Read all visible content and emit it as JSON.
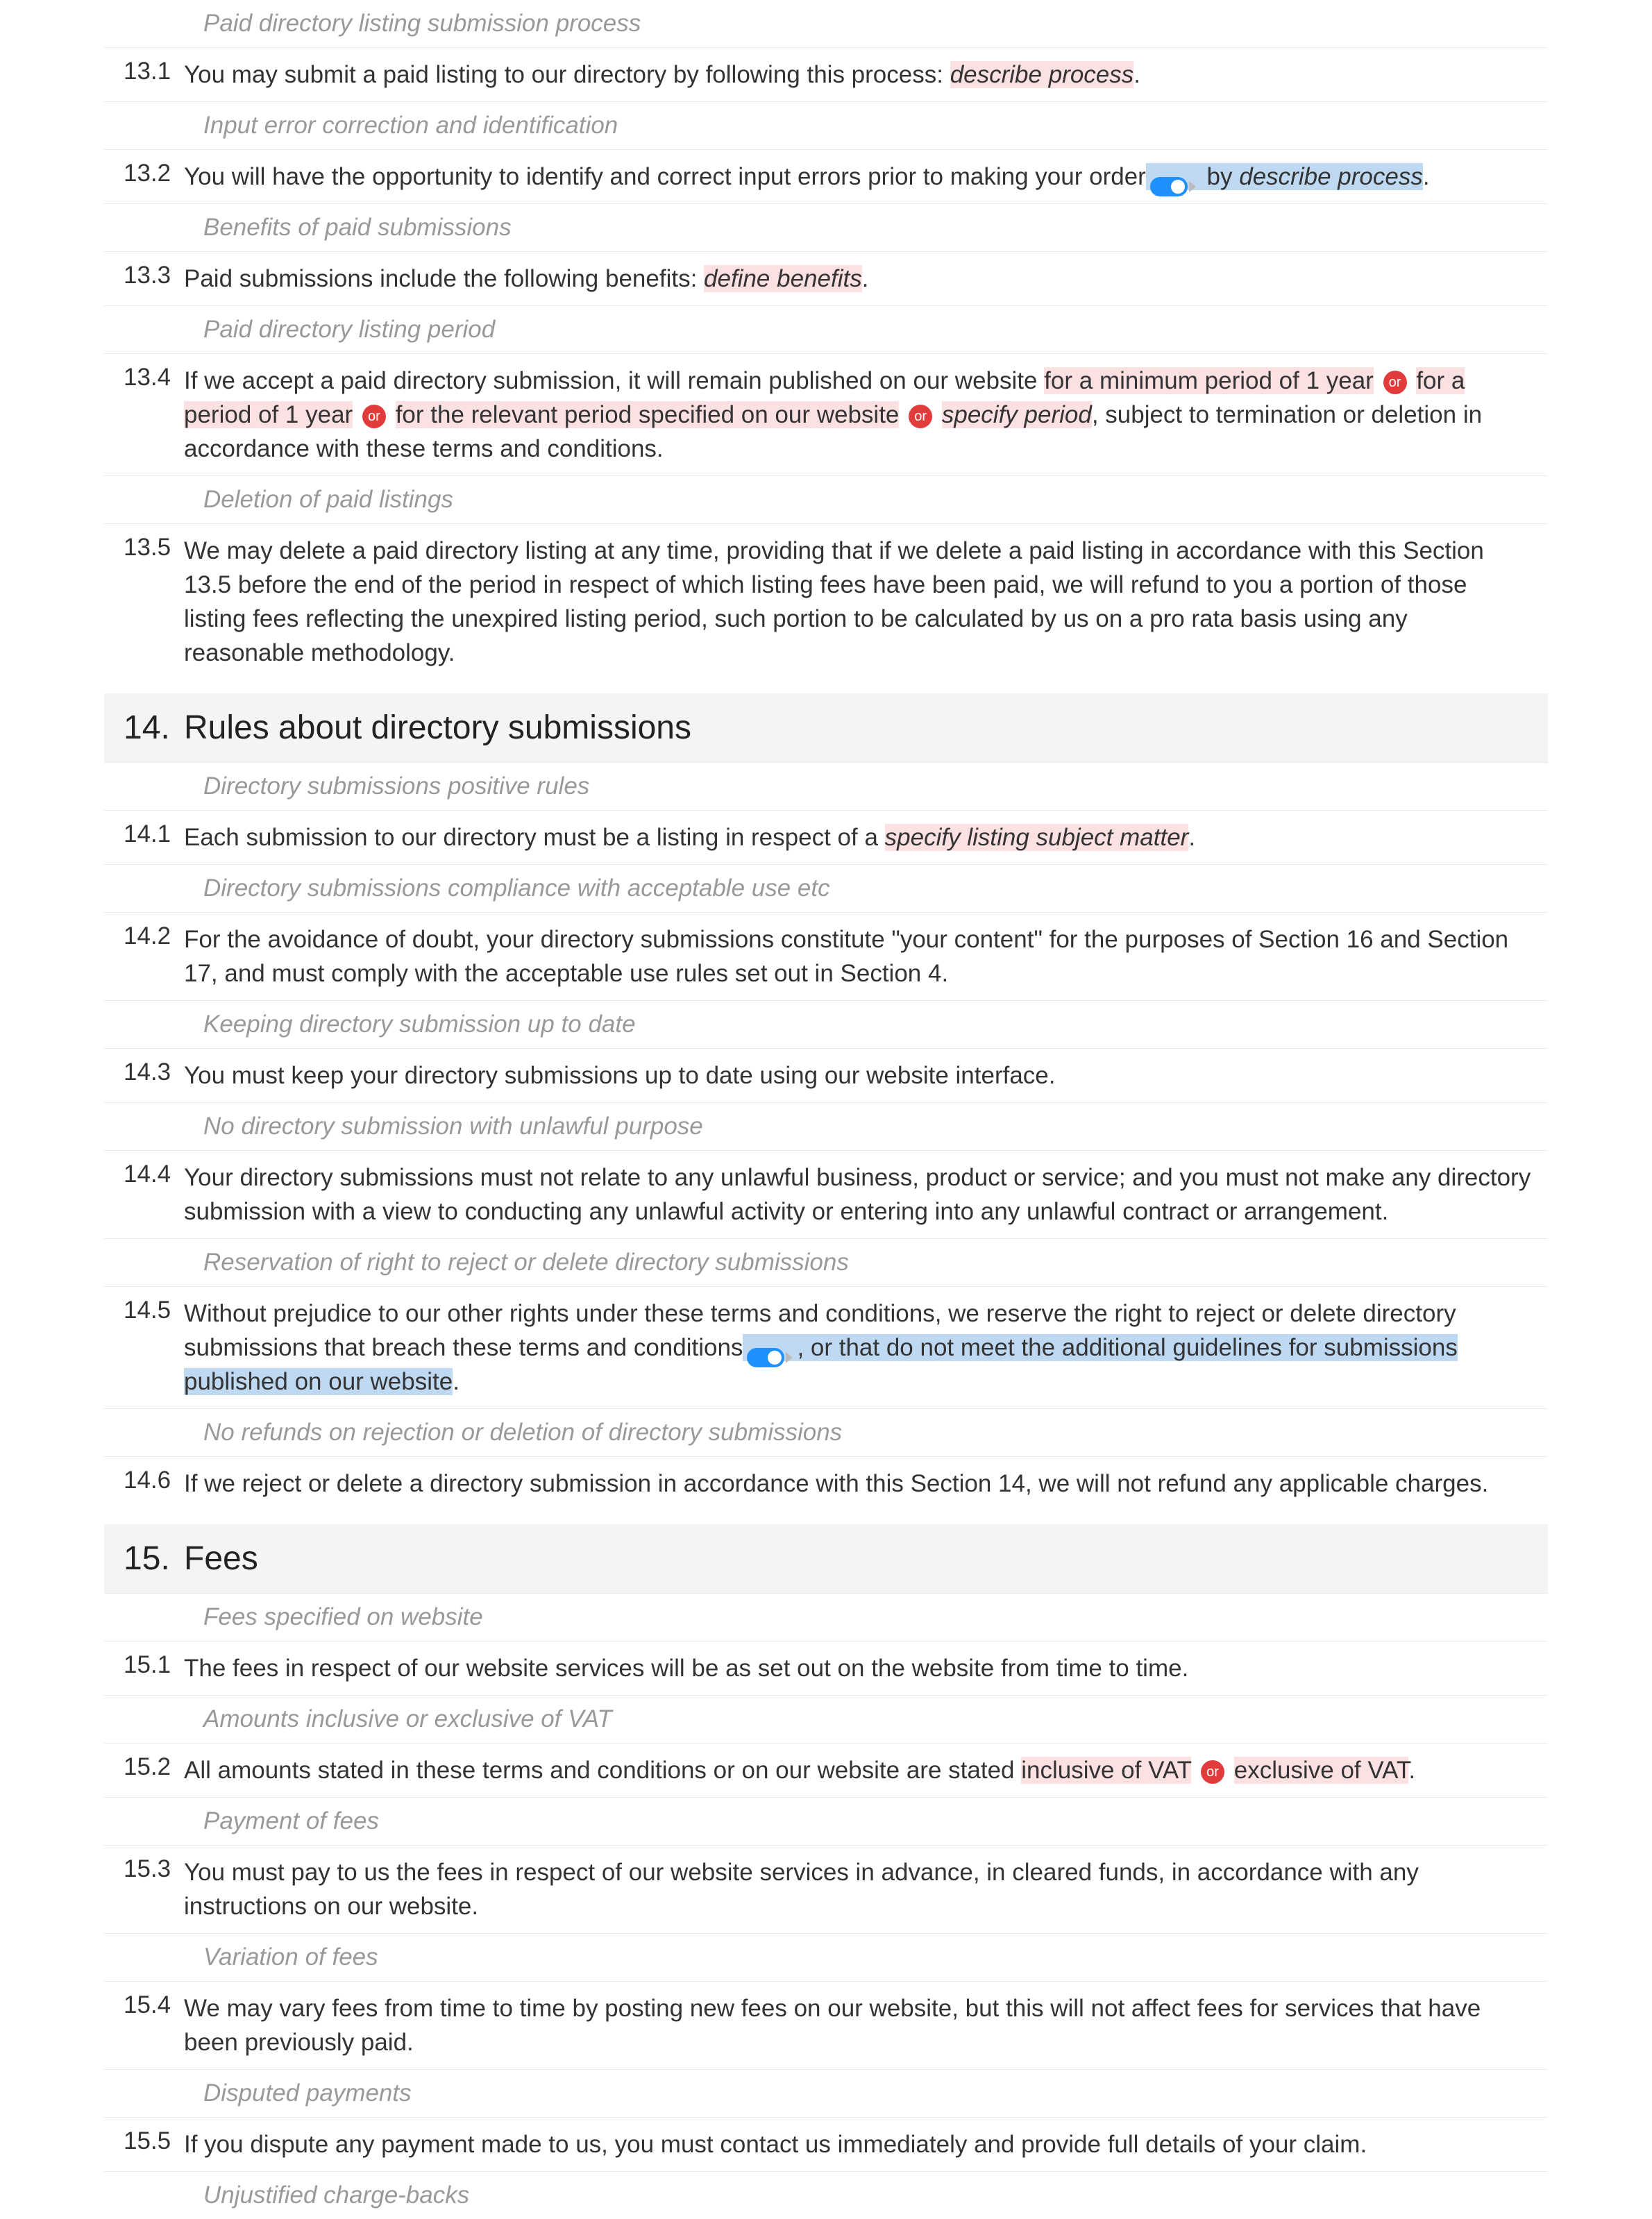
{
  "blocks": [
    {
      "type": "subheading",
      "text": "Paid directory listing submission process",
      "first": true
    },
    {
      "type": "clause",
      "num": "13.1",
      "segments": [
        {
          "text": "You may submit a paid listing to our directory by following this process: "
        },
        {
          "text": "describe process",
          "hl": "pink",
          "italic": true
        },
        {
          "text": "."
        }
      ]
    },
    {
      "type": "subheading",
      "text": "Input error correction and identification"
    },
    {
      "type": "clause",
      "num": "13.2",
      "segments": [
        {
          "text": "You will have the opportunity to identify and correct input errors prior to making your order"
        },
        {
          "toggle": true,
          "hl": "blue"
        },
        {
          "text": " by ",
          "hl": "blue"
        },
        {
          "text": "describe process",
          "hl": "blue",
          "italic": true
        },
        {
          "text": "."
        }
      ]
    },
    {
      "type": "subheading",
      "text": "Benefits of paid submissions"
    },
    {
      "type": "clause",
      "num": "13.3",
      "segments": [
        {
          "text": "Paid submissions include the following benefits: "
        },
        {
          "text": "define benefits",
          "hl": "pink",
          "italic": true
        },
        {
          "text": "."
        }
      ]
    },
    {
      "type": "subheading",
      "text": "Paid directory listing period"
    },
    {
      "type": "clause",
      "num": "13.4",
      "segments": [
        {
          "text": "If we accept a paid directory submission, it will remain published on our website "
        },
        {
          "text": "for a minimum period of 1 year",
          "hl": "pink"
        },
        {
          "or": true
        },
        {
          "text": "for a period of 1 year",
          "hl": "pink"
        },
        {
          "or": true
        },
        {
          "text": "for the relevant period specified on our website",
          "hl": "pink"
        },
        {
          "or": true
        },
        {
          "text": "specify period",
          "hl": "pink",
          "italic": true
        },
        {
          "text": ", subject to termination or deletion in accordance with these terms and conditions."
        }
      ]
    },
    {
      "type": "subheading",
      "text": "Deletion of paid listings"
    },
    {
      "type": "clause",
      "num": "13.5",
      "segments": [
        {
          "text": "We may delete a paid directory listing at any time, providing that if we delete a paid listing in accordance with this Section 13.5 before the end of the period in respect of which listing fees have been paid, we will refund to you a portion of those listing fees reflecting the unexpired listing period, such portion to be calculated by us on a pro rata basis using any reasonable methodology."
        }
      ]
    },
    {
      "type": "section",
      "num": "14.",
      "title": "Rules about directory submissions"
    },
    {
      "type": "subheading",
      "text": "Directory submissions positive rules"
    },
    {
      "type": "clause",
      "num": "14.1",
      "segments": [
        {
          "text": "Each submission to our directory must be a listing in respect of a "
        },
        {
          "text": "specify listing subject matter",
          "hl": "pink",
          "italic": true
        },
        {
          "text": "."
        }
      ]
    },
    {
      "type": "subheading",
      "text": "Directory submissions compliance with acceptable use etc"
    },
    {
      "type": "clause",
      "num": "14.2",
      "segments": [
        {
          "text": "For the avoidance of doubt, your directory submissions constitute \"your content\" for the purposes of Section 16 and Section 17, and must comply with the acceptable use rules set out in Section 4."
        }
      ]
    },
    {
      "type": "subheading",
      "text": "Keeping directory submission up to date"
    },
    {
      "type": "clause",
      "num": "14.3",
      "segments": [
        {
          "text": "You must keep your directory submissions up to date using our website interface."
        }
      ]
    },
    {
      "type": "subheading",
      "text": "No directory submission with unlawful purpose"
    },
    {
      "type": "clause",
      "num": "14.4",
      "segments": [
        {
          "text": "Your directory submissions must not relate to any unlawful business, product or service; and you must not make any directory submission with a view to conducting any unlawful activity or entering into any unlawful contract or arrangement."
        }
      ]
    },
    {
      "type": "subheading",
      "text": "Reservation of right to reject or delete directory submissions"
    },
    {
      "type": "clause",
      "num": "14.5",
      "segments": [
        {
          "text": "Without prejudice to our other rights under these terms and conditions, we reserve the right to reject or delete directory submissions that breach these terms and conditions"
        },
        {
          "toggle": true,
          "hl": "blue"
        },
        {
          "text": ", or that do not meet the additional guidelines for submissions published on our website",
          "hl": "blue"
        },
        {
          "text": "."
        }
      ]
    },
    {
      "type": "subheading",
      "text": "No refunds on rejection or deletion of directory submissions"
    },
    {
      "type": "clause",
      "num": "14.6",
      "segments": [
        {
          "text": "If we reject or delete a directory submission in accordance with this Section 14, we will not refund any applicable charges."
        }
      ]
    },
    {
      "type": "section",
      "num": "15.",
      "title": "Fees"
    },
    {
      "type": "subheading",
      "text": "Fees specified on website"
    },
    {
      "type": "clause",
      "num": "15.1",
      "segments": [
        {
          "text": "The fees in respect of our website services will be as set out on the website from time to time."
        }
      ]
    },
    {
      "type": "subheading",
      "text": "Amounts inclusive or exclusive of VAT"
    },
    {
      "type": "clause",
      "num": "15.2",
      "segments": [
        {
          "text": "All amounts stated in these terms and conditions or on our website are stated "
        },
        {
          "text": "inclusive of VAT",
          "hl": "pink"
        },
        {
          "or": true
        },
        {
          "text": "exclusive of VAT",
          "hl": "pink"
        },
        {
          "text": "."
        }
      ]
    },
    {
      "type": "subheading",
      "text": "Payment of fees"
    },
    {
      "type": "clause",
      "num": "15.3",
      "segments": [
        {
          "text": "You must pay to us the fees in respect of our website services in advance, in cleared funds, in accordance with any instructions on our website."
        }
      ]
    },
    {
      "type": "subheading",
      "text": "Variation of fees"
    },
    {
      "type": "clause",
      "num": "15.4",
      "segments": [
        {
          "text": "We may vary fees from time to time by posting new fees on our website, but this will not affect fees for services that have been previously paid."
        }
      ]
    },
    {
      "type": "subheading",
      "text": "Disputed payments"
    },
    {
      "type": "clause",
      "num": "15.5",
      "segments": [
        {
          "text": "If you dispute any payment made to us, you must contact us immediately and provide full details of your claim."
        }
      ]
    },
    {
      "type": "subheading",
      "text": "Unjustified charge-backs"
    }
  ],
  "or_label": "or"
}
